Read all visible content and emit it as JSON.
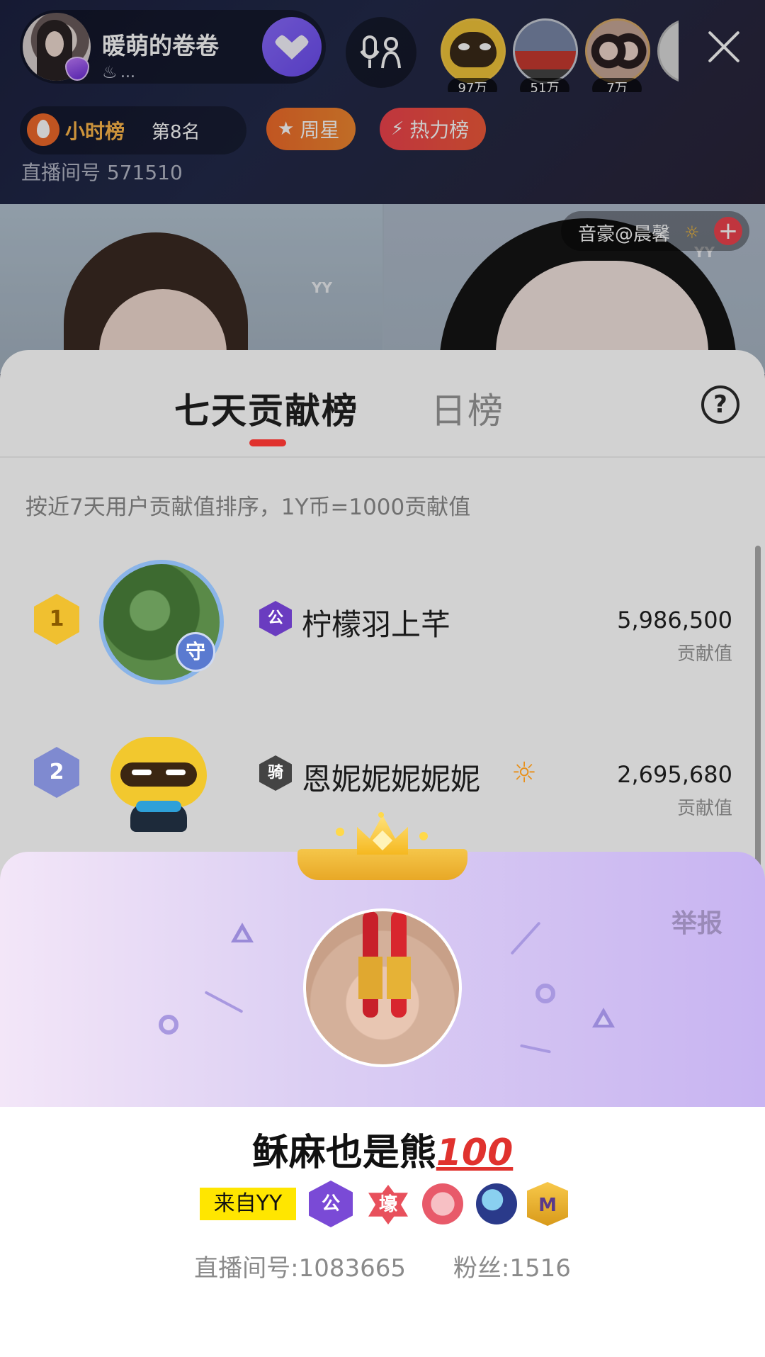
{
  "header": {
    "anchor_name": "暖萌的卷卷",
    "anchor_sub": "...",
    "top_viewers": [
      {
        "tag": "97万"
      },
      {
        "tag": "51万"
      },
      {
        "tag": "7万"
      }
    ],
    "hour_rank_label": "小时榜",
    "hour_rank_pos": "第8名",
    "week_star_label": "周星",
    "hot_rank_label": "热力榜",
    "room_id": "直播间号 571510"
  },
  "video": {
    "watermark": "YY",
    "guest_label": "音豪@晨馨"
  },
  "sheet": {
    "tab_active": "七天贡献榜",
    "tab_inactive": "日榜",
    "help": "?",
    "rule": "按近7天用户贡献值排序，1Y币=1000贡献值",
    "rows": [
      {
        "rank": "1",
        "badge": "公",
        "name": "柠檬羽上芊",
        "value": "5,986,500",
        "unit": "贡献值",
        "avatar_badge": "守"
      },
      {
        "rank": "2",
        "badge": "骑",
        "name": "恩妮妮妮妮妮",
        "value": "2,695,680",
        "unit": "贡献值"
      }
    ]
  },
  "profile": {
    "report": "举报",
    "name": "稣麻也是熊",
    "name_suffix": "100",
    "from": "来自YY",
    "badges": [
      "公",
      "壕",
      "",
      "",
      "M"
    ],
    "room": "直播间号:1083665",
    "fans": "粉丝:1516"
  },
  "colors": {
    "accent_red": "#e0322e",
    "gold": "#f0c030",
    "purple": "#7a4ad6"
  }
}
